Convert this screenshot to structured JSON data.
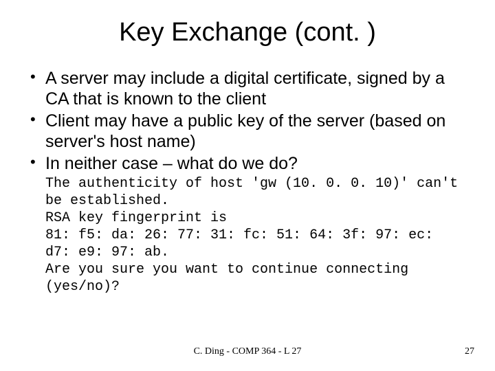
{
  "title": "Key Exchange (cont. )",
  "bullets": [
    "A server may include a digital certificate, signed by a CA that is known to the client",
    "Client may have a public key of the server (based on server's host name)",
    "In neither case – what do we do?"
  ],
  "mono": "The authenticity of host 'gw (10. 0. 0. 10)' can't be established.\nRSA key fingerprint is\n81: f5: da: 26: 77: 31: fc: 51: 64: 3f: 97: ec: d7: e9: 97: ab.\nAre you sure you want to continue connecting (yes/no)?",
  "footer": {
    "center": "C. Ding - COMP 364 - L 27",
    "right": "27"
  }
}
